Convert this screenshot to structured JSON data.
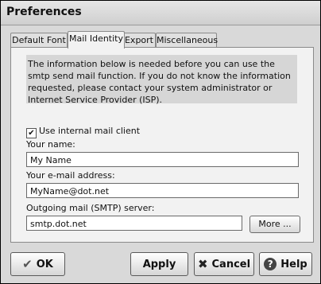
{
  "window": {
    "title": "Preferences"
  },
  "tabs": [
    {
      "label": "Default Font"
    },
    {
      "label": "Mail Identity"
    },
    {
      "label": "Export"
    },
    {
      "label": "Miscellaneous"
    }
  ],
  "panel": {
    "info_text": "The information below is needed before you can use the smtp send mail function. If you do not know the information requested, please contact your system administrator or Internet Service Provider (ISP).",
    "use_internal_label": "Use internal mail client",
    "use_internal_checked": true,
    "name_label": "Your name:",
    "name_value": "My Name",
    "email_label": "Your e-mail address:",
    "email_value": "MyName@dot.net",
    "smtp_label": "Outgoing mail (SMTP) server:",
    "smtp_value": "smtp.dot.net",
    "more_label": "More ..."
  },
  "buttons": {
    "ok": "OK",
    "apply": "Apply",
    "cancel": "Cancel",
    "help": "Help"
  }
}
